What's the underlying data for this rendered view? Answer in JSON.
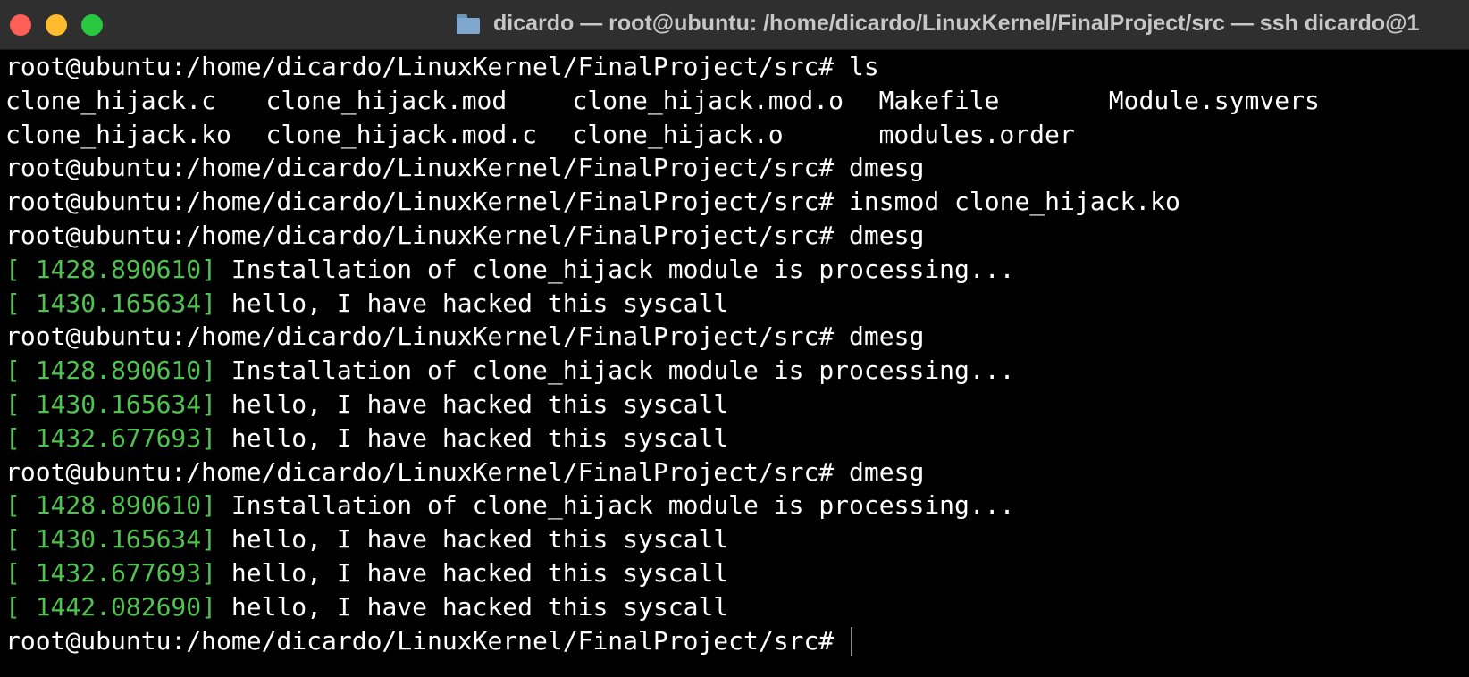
{
  "window": {
    "title": "dicardo — root@ubuntu: /home/dicardo/LinuxKernel/FinalProject/src — ssh dicardo@1",
    "buttons": [
      "close",
      "minimize",
      "zoom"
    ],
    "icon": "folder-icon"
  },
  "colors": {
    "background": "#000000",
    "titlebar": "#2f2f2f",
    "text": "#ffffff",
    "timestamp": "#4fc24f"
  },
  "terminal": {
    "prompt": "root@ubuntu:/home/dicardo/LinuxKernel/FinalProject/src#",
    "lines": [
      {
        "kind": "command",
        "command": "ls"
      },
      {
        "kind": "ls",
        "cells": [
          "clone_hijack.c",
          "clone_hijack.mod",
          "clone_hijack.mod.o",
          "Makefile",
          "Module.symvers"
        ]
      },
      {
        "kind": "ls",
        "cells": [
          "clone_hijack.ko",
          "clone_hijack.mod.c",
          "clone_hijack.o",
          "modules.order"
        ]
      },
      {
        "kind": "command",
        "command": "dmesg"
      },
      {
        "kind": "command",
        "command": "insmod clone_hijack.ko"
      },
      {
        "kind": "command",
        "command": "dmesg"
      },
      {
        "kind": "log",
        "timestamp": "[ 1428.890610]",
        "message": "Installation of clone_hijack module is processing..."
      },
      {
        "kind": "log",
        "timestamp": "[ 1430.165634]",
        "message": "hello, I have hacked this syscall"
      },
      {
        "kind": "command",
        "command": "dmesg"
      },
      {
        "kind": "log",
        "timestamp": "[ 1428.890610]",
        "message": "Installation of clone_hijack module is processing..."
      },
      {
        "kind": "log",
        "timestamp": "[ 1430.165634]",
        "message": "hello, I have hacked this syscall"
      },
      {
        "kind": "log",
        "timestamp": "[ 1432.677693]",
        "message": "hello, I have hacked this syscall"
      },
      {
        "kind": "command",
        "command": "dmesg"
      },
      {
        "kind": "log",
        "timestamp": "[ 1428.890610]",
        "message": "Installation of clone_hijack module is processing..."
      },
      {
        "kind": "log",
        "timestamp": "[ 1430.165634]",
        "message": "hello, I have hacked this syscall"
      },
      {
        "kind": "log",
        "timestamp": "[ 1432.677693]",
        "message": "hello, I have hacked this syscall"
      },
      {
        "kind": "log",
        "timestamp": "[ 1442.082690]",
        "message": "hello, I have hacked this syscall"
      },
      {
        "kind": "command",
        "command": ""
      }
    ]
  }
}
